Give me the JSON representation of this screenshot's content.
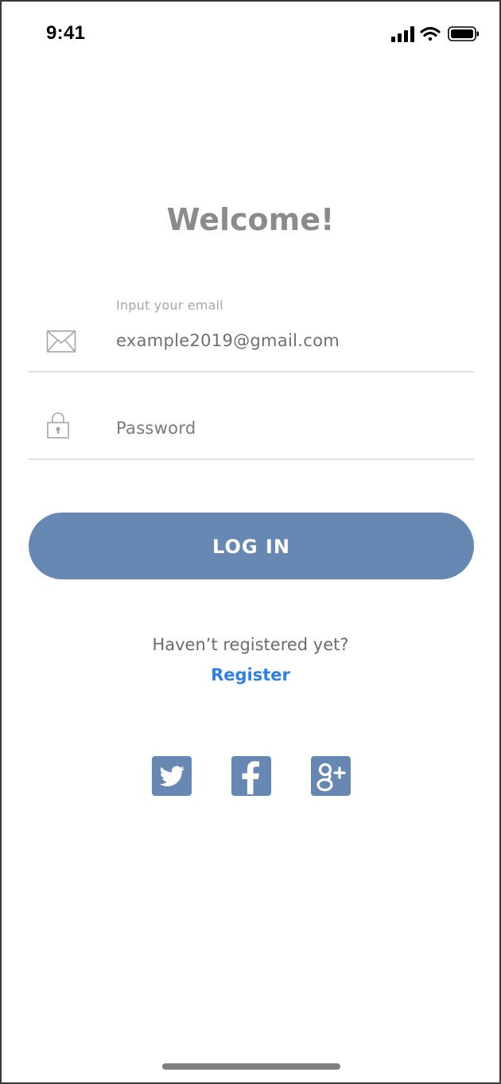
{
  "status_bar": {
    "time": "9:41"
  },
  "welcome_title": "Welcome!",
  "email_field": {
    "label": "Input your email",
    "value": "example2019@gmail.com",
    "icon": "envelope-icon"
  },
  "password_field": {
    "placeholder": "Password",
    "value": "",
    "icon": "lock-icon"
  },
  "login_button": {
    "label": "LOG IN"
  },
  "register": {
    "prompt": "Haven’t registered yet?",
    "link_label": "Register"
  },
  "social": [
    {
      "network": "twitter",
      "icon": "twitter-icon"
    },
    {
      "network": "facebook",
      "icon": "facebook-icon"
    },
    {
      "network": "google-plus",
      "icon": "google-plus-icon"
    }
  ],
  "colors": {
    "accent": "#6888b4",
    "link": "#2f80ed",
    "title": "#8b8b8b",
    "divider": "#e0e0e0"
  }
}
